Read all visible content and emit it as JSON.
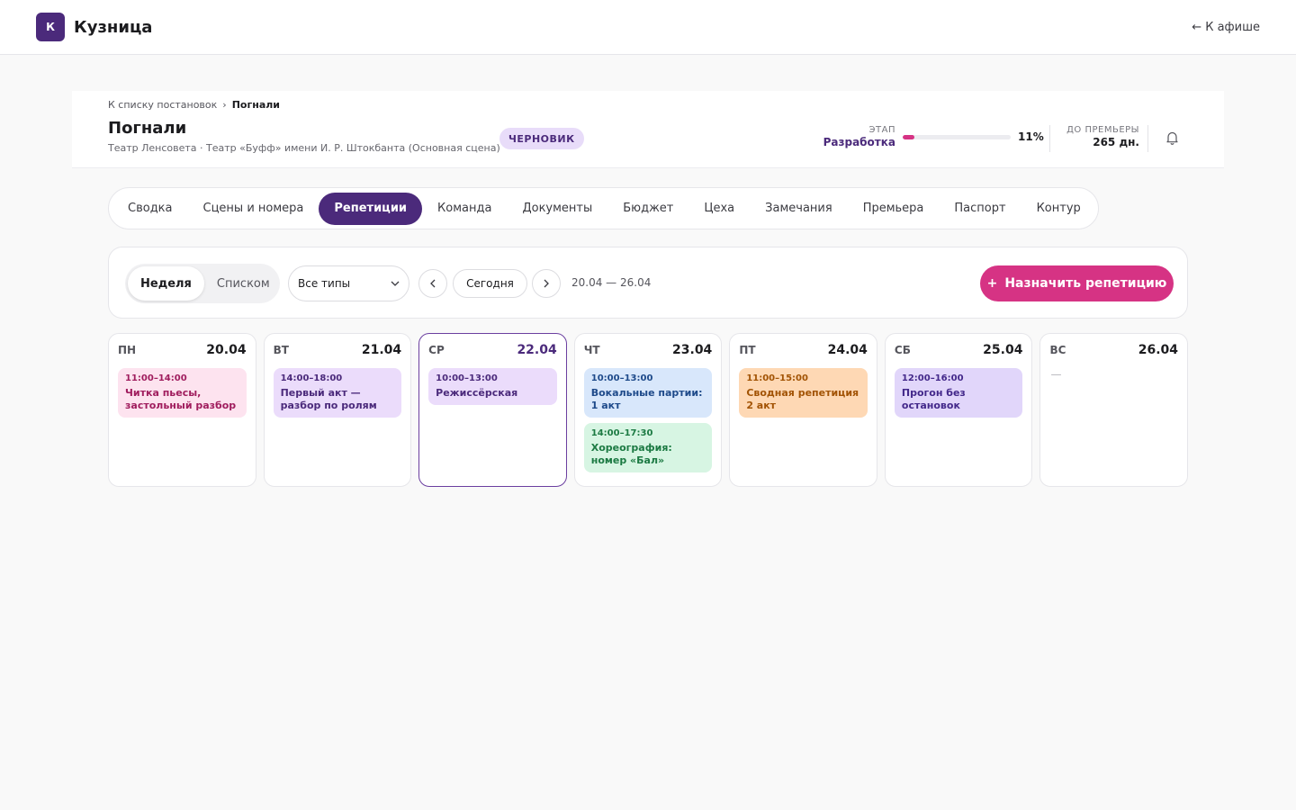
{
  "app": {
    "logo_letter": "К",
    "name": "Кузница",
    "back_link": "← К афише"
  },
  "production": {
    "breadcrumb": {
      "parent": "К списку постановок",
      "separator": "›",
      "current": "Погнали"
    },
    "title": "Погнали",
    "venue": "Театр Ленсовета · Театр «Буфф» имени И. Р. Штокбанта (Основная сцена)",
    "status": "ЧЕРНОВИК",
    "stage_label": "ЭТАП",
    "stage_value": "Разработка",
    "progress_percent": 11,
    "progress_label": "11%",
    "premiere_label": "ДО ПРЕМЬЕРЫ",
    "premiere_value": "265 дн."
  },
  "tabs": [
    {
      "label": "Сводка",
      "active": false
    },
    {
      "label": "Сцены и номера",
      "active": false
    },
    {
      "label": "Репетиции",
      "active": true
    },
    {
      "label": "Команда",
      "active": false
    },
    {
      "label": "Документы",
      "active": false
    },
    {
      "label": "Бюджет",
      "active": false
    },
    {
      "label": "Цеха",
      "active": false
    },
    {
      "label": "Замечания",
      "active": false
    },
    {
      "label": "Премьера",
      "active": false
    },
    {
      "label": "Паспорт",
      "active": false
    },
    {
      "label": "Контур",
      "active": false
    }
  ],
  "toolbar": {
    "view_week": "Неделя",
    "view_list": "Списком",
    "type_filter": "Все типы",
    "today": "Сегодня",
    "date_range": "20.04 — 26.04",
    "add_label": "Назначить репетицию",
    "add_plus": "+"
  },
  "week": [
    {
      "name": "ПН",
      "date": "20.04",
      "today": false,
      "events": [
        {
          "time": "11:00–14:00",
          "title": "Читка пьесы, застольный разбор",
          "color": "pink"
        }
      ]
    },
    {
      "name": "ВТ",
      "date": "21.04",
      "today": false,
      "events": [
        {
          "time": "14:00–18:00",
          "title": "Первый акт — разбор по ролям",
          "color": "lav"
        }
      ]
    },
    {
      "name": "СР",
      "date": "22.04",
      "today": true,
      "events": [
        {
          "time": "10:00–13:00",
          "title": "Режиссёрская",
          "color": "lav"
        }
      ]
    },
    {
      "name": "ЧТ",
      "date": "23.04",
      "today": false,
      "events": [
        {
          "time": "10:00–13:00",
          "title": "Вокальные партии: 1 акт",
          "color": "blue"
        },
        {
          "time": "14:00–17:30",
          "title": "Хореография: номер «Бал»",
          "color": "green"
        }
      ]
    },
    {
      "name": "ПТ",
      "date": "24.04",
      "today": false,
      "events": [
        {
          "time": "11:00–15:00",
          "title": "Сводная репетиция 2 акт",
          "color": "orange"
        }
      ]
    },
    {
      "name": "СБ",
      "date": "25.04",
      "today": false,
      "events": [
        {
          "time": "12:00–16:00",
          "title": "Прогон без остановок",
          "color": "violet"
        }
      ]
    },
    {
      "name": "ВС",
      "date": "26.04",
      "today": false,
      "events": [],
      "empty": "—"
    }
  ],
  "colors": {
    "brand": "#4b2a7b",
    "accent": "#d63384"
  }
}
